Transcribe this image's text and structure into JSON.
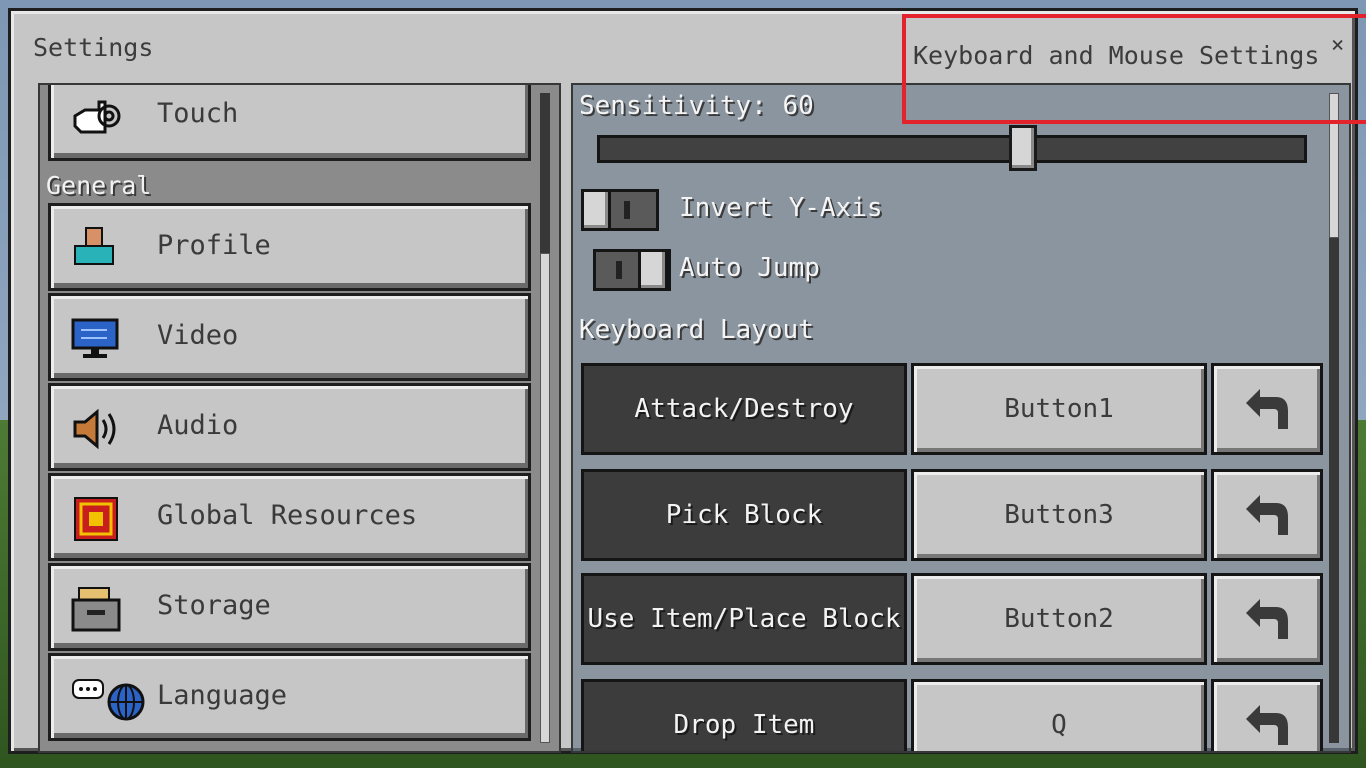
{
  "window": {
    "title": "Settings",
    "subtitle": "Keyboard and Mouse Settings",
    "close_symbol": "×"
  },
  "sidebar": {
    "top_item": {
      "label": "Touch",
      "icon": "touch-hand-icon"
    },
    "section_label": "General",
    "items": [
      {
        "label": "Profile",
        "icon": "profile-icon"
      },
      {
        "label": "Video",
        "icon": "monitor-icon"
      },
      {
        "label": "Audio",
        "icon": "speaker-icon"
      },
      {
        "label": "Global Resources",
        "icon": "resources-icon"
      },
      {
        "label": "Storage",
        "icon": "storage-icon"
      },
      {
        "label": "Language",
        "icon": "language-globe-icon"
      }
    ]
  },
  "controls": {
    "sensitivity_label": "Sensitivity: 60",
    "sensitivity_value": 60,
    "invert_y_label": "Invert Y-Axis",
    "invert_y_on": false,
    "auto_jump_label": "Auto Jump",
    "auto_jump_on": true,
    "keyboard_layout_label": "Keyboard Layout"
  },
  "bindings": [
    {
      "action": "Attack/Destroy",
      "key": "Button1"
    },
    {
      "action": "Pick Block",
      "key": "Button3"
    },
    {
      "action": "Use Item/Place Block",
      "key": "Button2"
    },
    {
      "action": "Drop Item",
      "key": "Q"
    }
  ],
  "colors": {
    "highlight": "#e3232c",
    "panel": "#c6c6c6",
    "action_bg": "#3c3c3c"
  }
}
